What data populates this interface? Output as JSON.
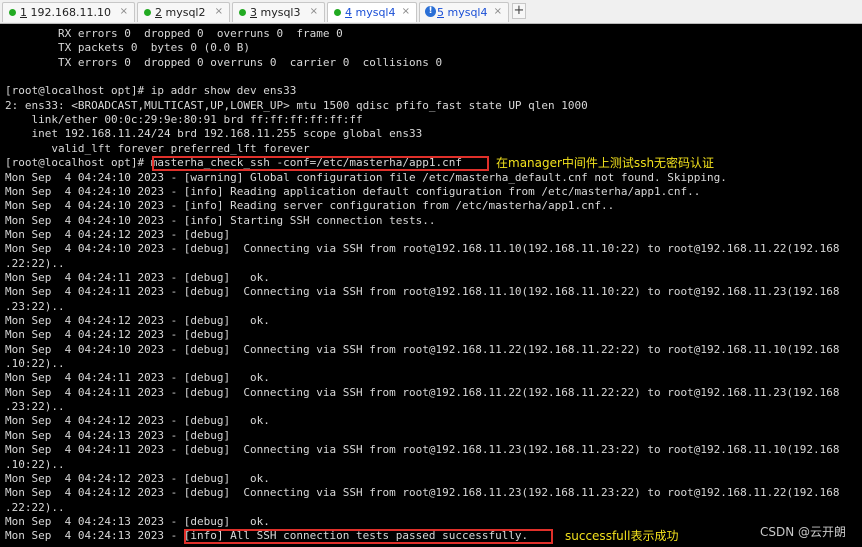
{
  "tabs": [
    {
      "status": "green",
      "num": "1",
      "rest": " 192.168.11.10",
      "active": false,
      "link": false
    },
    {
      "status": "green",
      "num": "2",
      "rest": " mysql2",
      "active": false,
      "link": false
    },
    {
      "status": "green",
      "num": "3",
      "rest": " mysql3",
      "active": false,
      "link": false
    },
    {
      "status": "green",
      "num": "4",
      "rest": " mysql4",
      "active": true,
      "link": true
    },
    {
      "status": "info",
      "num": "5",
      "rest": " mysql4",
      "active": false,
      "link": true
    }
  ],
  "tab_close_glyph": "×",
  "tab_add_glyph": "+",
  "terminal_lines": [
    "        RX errors 0  dropped 0  overruns 0  frame 0",
    "        TX packets 0  bytes 0 (0.0 B)",
    "        TX errors 0  dropped 0 overruns 0  carrier 0  collisions 0",
    "",
    "[root@localhost opt]# ip addr show dev ens33",
    "2: ens33: <BROADCAST,MULTICAST,UP,LOWER_UP> mtu 1500 qdisc pfifo_fast state UP qlen 1000",
    "    link/ether 00:0c:29:9e:80:91 brd ff:ff:ff:ff:ff:ff",
    "    inet 192.168.11.24/24 brd 192.168.11.255 scope global ens33",
    "       valid_lft forever preferred_lft forever",
    "[root@localhost opt]# masterha_check_ssh -conf=/etc/masterha/app1.cnf",
    "Mon Sep  4 04:24:10 2023 - [warning] Global configuration file /etc/masterha_default.cnf not found. Skipping.",
    "Mon Sep  4 04:24:10 2023 - [info] Reading application default configuration from /etc/masterha/app1.cnf..",
    "Mon Sep  4 04:24:10 2023 - [info] Reading server configuration from /etc/masterha/app1.cnf..",
    "Mon Sep  4 04:24:10 2023 - [info] Starting SSH connection tests..",
    "Mon Sep  4 04:24:12 2023 - [debug]",
    "Mon Sep  4 04:24:10 2023 - [debug]  Connecting via SSH from root@192.168.11.10(192.168.11.10:22) to root@192.168.11.22(192.168",
    ".22:22)..",
    "Mon Sep  4 04:24:11 2023 - [debug]   ok.",
    "Mon Sep  4 04:24:11 2023 - [debug]  Connecting via SSH from root@192.168.11.10(192.168.11.10:22) to root@192.168.11.23(192.168",
    ".23:22)..",
    "Mon Sep  4 04:24:12 2023 - [debug]   ok.",
    "Mon Sep  4 04:24:12 2023 - [debug]",
    "Mon Sep  4 04:24:10 2023 - [debug]  Connecting via SSH from root@192.168.11.22(192.168.11.22:22) to root@192.168.11.10(192.168",
    ".10:22)..",
    "Mon Sep  4 04:24:11 2023 - [debug]   ok.",
    "Mon Sep  4 04:24:11 2023 - [debug]  Connecting via SSH from root@192.168.11.22(192.168.11.22:22) to root@192.168.11.23(192.168",
    ".23:22)..",
    "Mon Sep  4 04:24:12 2023 - [debug]   ok.",
    "Mon Sep  4 04:24:13 2023 - [debug]",
    "Mon Sep  4 04:24:11 2023 - [debug]  Connecting via SSH from root@192.168.11.23(192.168.11.23:22) to root@192.168.11.10(192.168",
    ".10:22)..",
    "Mon Sep  4 04:24:12 2023 - [debug]   ok.",
    "Mon Sep  4 04:24:12 2023 - [debug]  Connecting via SSH from root@192.168.11.23(192.168.11.23:22) to root@192.168.11.22(192.168",
    ".22:22)..",
    "Mon Sep  4 04:24:13 2023 - [debug]   ok.",
    "Mon Sep  4 04:24:13 2023 - [info] All SSH connection tests passed successfully."
  ],
  "annotations": {
    "command_note": "在manager中间件上测试ssh无密码认证",
    "success_note": "successfull表示成功"
  },
  "watermark": "CSDN @云开朗",
  "colors": {
    "terminal_bg": "#000000",
    "terminal_text": "#d8d8d8",
    "annotation": "#f3e21d",
    "highlight_box": "#e0302a",
    "tab_status_green": "#22aa22",
    "tab_info_blue": "#2a6fd6"
  }
}
